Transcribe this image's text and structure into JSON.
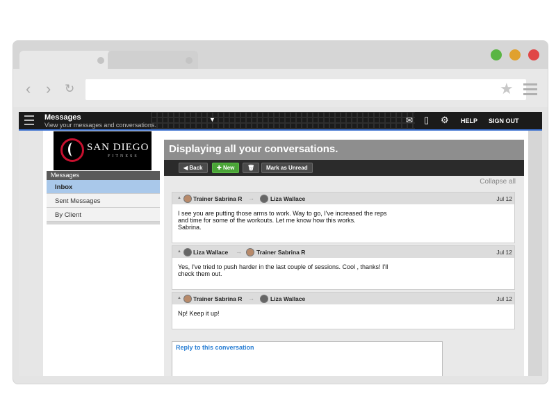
{
  "app": {
    "title": "Messages",
    "subtitle": "View your messages and conversations.",
    "header_links": {
      "help": "HELP",
      "signout": "SIGN OUT"
    }
  },
  "logo": {
    "brand": "SAN DIEGO",
    "tagline": "FITNESS"
  },
  "sidebar": {
    "heading": "Messages",
    "items": [
      {
        "label": "Inbox",
        "active": true
      },
      {
        "label": "Sent Messages",
        "active": false
      },
      {
        "label": "By Client",
        "active": false
      }
    ]
  },
  "main": {
    "banner": "Displaying all your conversations.",
    "toolbar": {
      "back": "Back",
      "new": "New",
      "mark_unread": "Mark as Unread"
    },
    "collapse_all": "Collapse all",
    "messages": [
      {
        "from": "Trainer Sabrina R",
        "to": "Liza Wallace",
        "date": "Jul 12",
        "body_lines": [
          "I see you are putting those arms to work. Way to go, I've increased the reps",
          "and time for some of the workouts. Let me know how this works.",
          "Sabrina."
        ]
      },
      {
        "from": "Liza Wallace",
        "to": "Trainer Sabrina R",
        "date": "Jul 12",
        "body_lines": [
          "Yes, I've tried to push harder in the last couple of sessions. Cool , thanks! I'll",
          "check them out."
        ]
      },
      {
        "from": "Trainer Sabrina R",
        "to": "Liza Wallace",
        "date": "Jul 12",
        "body_lines": [
          "Np! Keep it up!"
        ]
      }
    ],
    "reply_label": "Reply to this conversation"
  },
  "colors": {
    "accent_blue": "#3a6fcf",
    "new_button": "#4aa437",
    "active_sidebar": "#a9c8ea",
    "reply_link": "#2a7fd4"
  },
  "icons": [
    "back-icon",
    "forward-icon",
    "reload-icon",
    "star-icon",
    "browser-menu-icon",
    "hamburger-icon",
    "dropdown-caret-icon",
    "mail-icon",
    "mobile-icon",
    "gear-icon",
    "trash-icon",
    "avatar-icon"
  ]
}
